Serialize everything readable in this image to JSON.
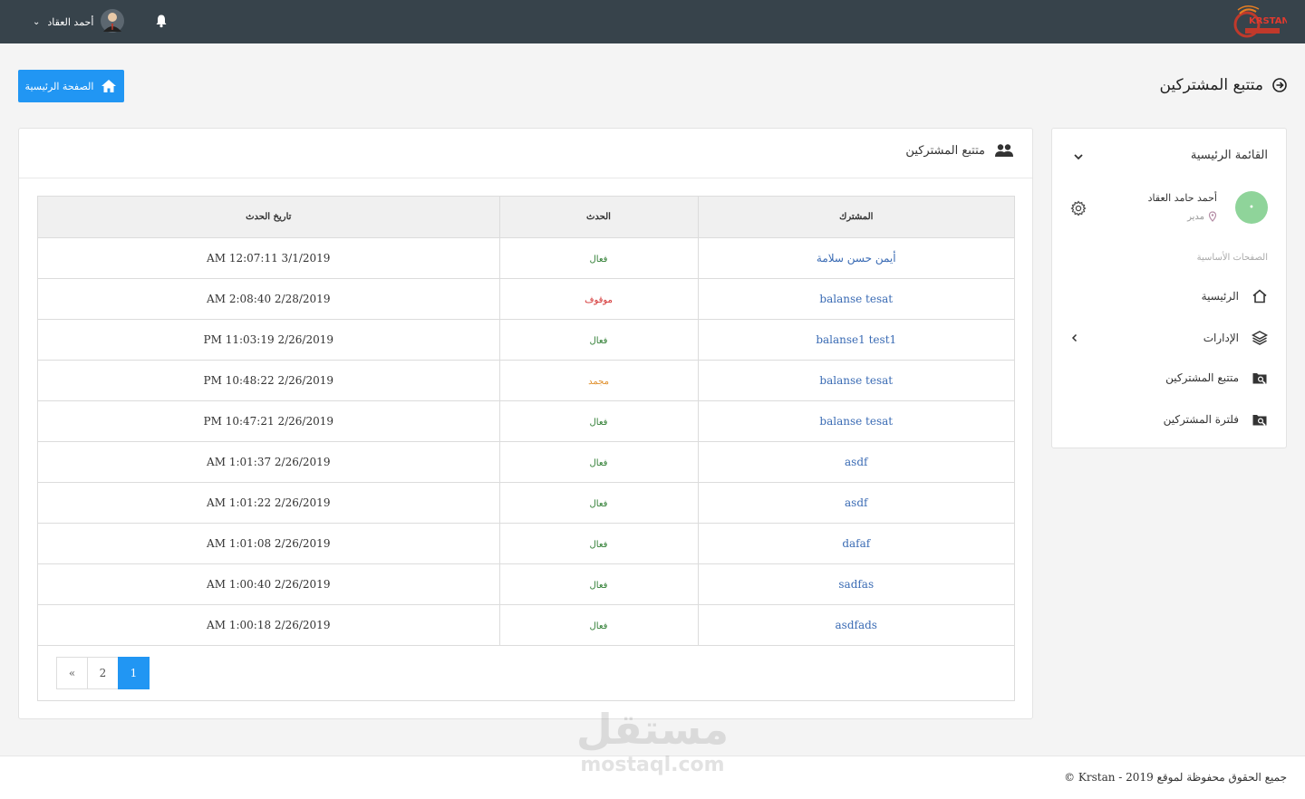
{
  "header": {
    "logo_text": "KRSTAN",
    "user_name": "أحمد العقاد"
  },
  "page": {
    "title": "متتبع المشتركين",
    "home_button": "الصفحة الرئيسية"
  },
  "sidebar": {
    "menu_title": "القائمة الرئيسية",
    "profile_name": "أحمد حامد العقاد",
    "profile_role": "مدير",
    "section_label": "الصفحات الأساسية",
    "items": [
      {
        "label": "الرئيسية",
        "icon": "home-icon"
      },
      {
        "label": "الإدارات",
        "icon": "layers-icon"
      },
      {
        "label": "متتبع المشتركين",
        "icon": "tracker-icon"
      },
      {
        "label": "فلترة المشتركين",
        "icon": "filter-icon"
      }
    ]
  },
  "card": {
    "title": "متتبع المشتركين",
    "columns": [
      "المشترك",
      "الحدث",
      "تاريخ الحدث"
    ],
    "rows": [
      {
        "subscriber": "أيمن حسن سلامة",
        "event": "فعال",
        "event_color": "#2e7d32",
        "date": "3/1/2019 12:07:11 AM"
      },
      {
        "subscriber": "balanse tesat",
        "event": "موقوف",
        "event_color": "#d32f2f",
        "date": "2/28/2019 2:08:40 AM"
      },
      {
        "subscriber": "balanse1 test1",
        "event": "فعال",
        "event_color": "#2e7d32",
        "date": "2/26/2019 11:03:19 PM"
      },
      {
        "subscriber": "balanse tesat",
        "event": "مجمد",
        "event_color": "#e0912f",
        "date": "2/26/2019 10:48:22 PM"
      },
      {
        "subscriber": "balanse tesat",
        "event": "فعال",
        "event_color": "#2e7d32",
        "date": "2/26/2019 10:47:21 PM"
      },
      {
        "subscriber": "asdf",
        "event": "فعال",
        "event_color": "#2e7d32",
        "date": "2/26/2019 1:01:37 AM"
      },
      {
        "subscriber": "asdf",
        "event": "فعال",
        "event_color": "#2e7d32",
        "date": "2/26/2019 1:01:22 AM"
      },
      {
        "subscriber": "dafaf",
        "event": "فعال",
        "event_color": "#2e7d32",
        "date": "2/26/2019 1:01:08 AM"
      },
      {
        "subscriber": "sadfas",
        "event": "فعال",
        "event_color": "#2e7d32",
        "date": "2/26/2019 1:00:40 AM"
      },
      {
        "subscriber": "asdfads",
        "event": "فعال",
        "event_color": "#2e7d32",
        "date": "2/26/2019 1:00:18 AM"
      }
    ],
    "pagination": {
      "prev": "«",
      "pages": [
        "2",
        "1"
      ]
    }
  },
  "footer": {
    "text": "جميع الحقوق محفوظة لموقع 2019 - Krstan ©"
  },
  "watermark": {
    "arabic": "مستقل",
    "latin": "mostaql.com"
  },
  "colors": {
    "topbar": "#37434b",
    "accent": "#2196f3",
    "link": "#3a6bb4"
  }
}
